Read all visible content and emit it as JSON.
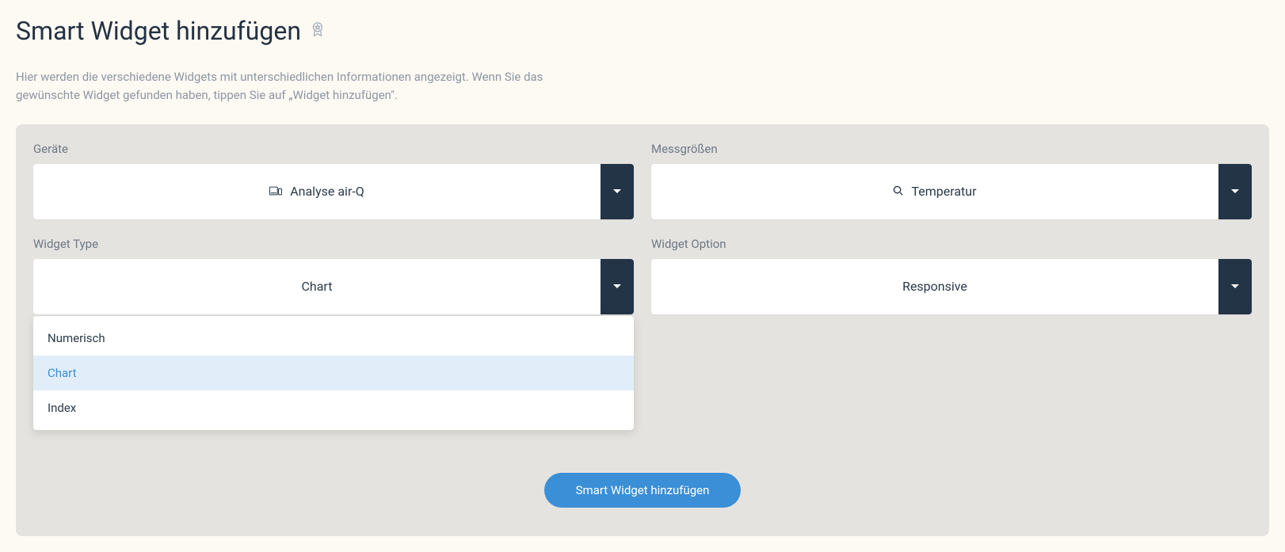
{
  "header": {
    "title": "Smart Widget hinzufügen"
  },
  "description": "Hier werden die verschiedene Widgets mit unterschiedlichen Informationen angezeigt. Wenn Sie das gewünschte Widget gefunden haben, tippen Sie auf „Widget hinzufügen\".",
  "fields": {
    "devices": {
      "label": "Geräte",
      "value": "Analyse air-Q"
    },
    "measurements": {
      "label": "Messgrößen",
      "value": "Temperatur"
    },
    "widgetType": {
      "label": "Widget Type",
      "value": "Chart",
      "options": [
        {
          "label": "Numerisch",
          "selected": false
        },
        {
          "label": "Chart",
          "selected": true
        },
        {
          "label": "Index",
          "selected": false
        }
      ]
    },
    "widgetOption": {
      "label": "Widget Option",
      "value": "Responsive"
    }
  },
  "submit": {
    "label": "Smart Widget hinzufügen"
  }
}
